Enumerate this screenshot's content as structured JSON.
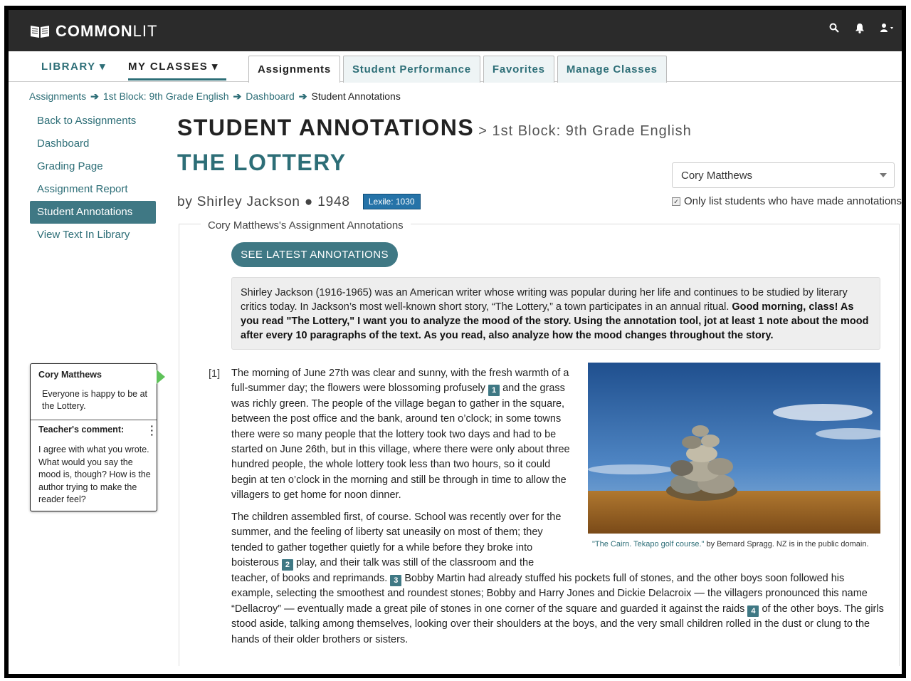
{
  "app": {
    "logo_bold": "COMMON",
    "logo_light": "LIT"
  },
  "nav": {
    "library": "LIBRARY ▾",
    "my_classes": "MY CLASSES ▾",
    "tabs": [
      "Assignments",
      "Student Performance",
      "Favorites",
      "Manage Classes"
    ]
  },
  "breadcrumb": [
    "Assignments",
    "1st Block: 9th Grade English",
    "Dashboard",
    "Student Annotations"
  ],
  "sidebar": {
    "items": [
      "Back to Assignments",
      "Dashboard",
      "Grading Page",
      "Assignment Report",
      "Student Annotations",
      "View Text In Library"
    ]
  },
  "page": {
    "title": "STUDENT ANNOTATIONS",
    "subtitle": "> 1st Block: 9th Grade English",
    "text_title": "THE LOTTERY",
    "author": "by Shirley Jackson",
    "year": "1948",
    "lexile": "Lexile: 1030"
  },
  "student_select": {
    "value": "Cory Matthews",
    "only_list": "Only list students who have made annotations"
  },
  "annotations_panel": {
    "legend": "Cory Matthews's Assignment Annotations",
    "latest_button": "SEE LATEST ANNOTATIONS",
    "intro_plain": "Shirley Jackson (1916-1965) was an American writer whose writing was popular during her life and continues to be studied by literary critics today. In Jackson’s most well-known short story, “The Lottery,” a town participates in an annual ritual.",
    "intro_bold": "Good morning, class! As you read \"The Lottery,\" I want you to analyze the mood of the story. Using the annotation tool, jot at least 1 note about the mood after every 10 paragraphs of the text. As you read, also analyze how the mood changes throughout the story."
  },
  "text": {
    "p1_num": "[1]",
    "p1_a": "The morning of June 27th was clear and sunny, with the fresh warmth of a full-summer day; the flowers were blossoming profusely",
    "p1_b": "and the grass was richly green. The people of the village began to gather in the square, between the post office and the bank, around ten o’clock; in some towns there were so many people that the lottery took two days and had to be started on June 26th, but in this village, where there were only about three hundred people, the whole lottery took less than two hours, so it could begin at ten o’clock in the morning and still be through in time to allow the villagers to get home for noon dinner.",
    "p2_a": "The children assembled first, of course. School was recently over for the summer, and the feeling of liberty sat uneasily on most of them; they tended to gather together quietly for a while before they broke into boisterous",
    "p2_b": "play, and their talk was still of the classroom and the",
    "p2_c": "teacher, of books and reprimands.",
    "p2_d": "Bobby Martin had already stuffed his pockets full of stones, and the other boys soon followed his example, selecting the smoothest and roundest stones; Bobby and Harry Jones and Dickie Delacroix — the villagers pronounced this name “Dellacroy” — eventually made a great pile of stones in one corner of the square and guarded it against the raids",
    "p2_e": "of the other boys. The girls stood aside, talking among themselves, looking over their shoulders at the boys, and the very small children rolled in the dust or clung to the hands of their older brothers or sisters.",
    "notes": [
      "1",
      "2",
      "3",
      "4"
    ]
  },
  "image_caption": {
    "link": "\"The Cairn. Tekapo golf course.\"",
    "rest": " by Bernard Spragg. NZ is in the public domain."
  },
  "annotation_card": {
    "student": "Cory Matthews",
    "note": "Everyone is happy to be at the Lottery.",
    "teacher_label": "Teacher's comment:",
    "teacher_comment": "I agree with what you wrote. What would you say the mood is, though? How is the author trying to make the reader feel?"
  },
  "colors": {
    "teal": "#3f7884",
    "topbar": "#2b2b2b",
    "lexile": "#2573a8"
  }
}
